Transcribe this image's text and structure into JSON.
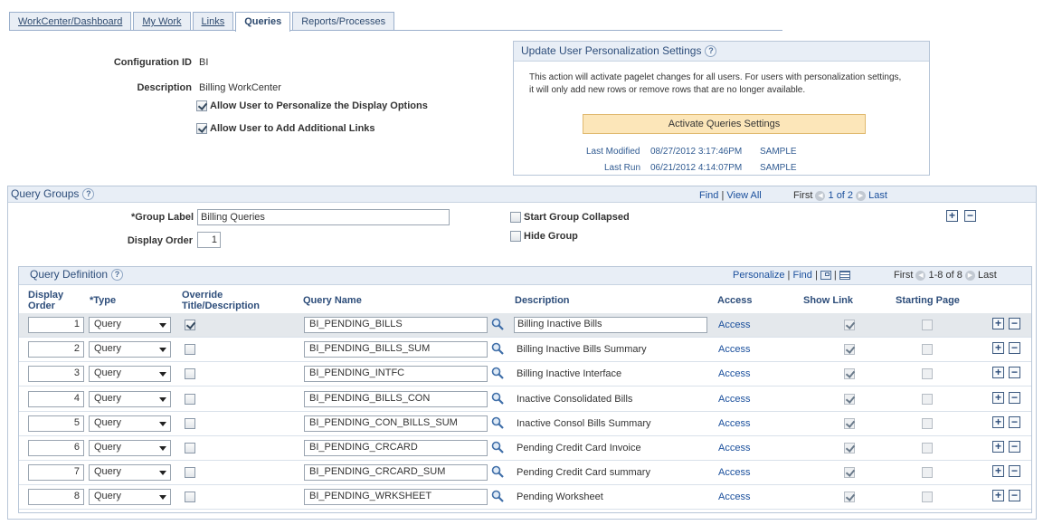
{
  "tabs": [
    {
      "label": "WorkCenter/Dashboard",
      "active": false
    },
    {
      "label": "My Work",
      "active": false
    },
    {
      "label": "Links",
      "active": false
    },
    {
      "label": "Queries",
      "active": true
    },
    {
      "label": "Reports/Processes",
      "active": false
    }
  ],
  "config": {
    "id_label": "Configuration ID",
    "id_value": "BI",
    "desc_label": "Description",
    "desc_value": "Billing WorkCenter",
    "allow_personalize_label": "Allow User to Personalize the Display Options",
    "allow_personalize_checked": true,
    "allow_links_label": "Allow User to Add Additional Links",
    "allow_links_checked": true
  },
  "update_panel": {
    "title": "Update User Personalization Settings",
    "text_line1": "This action will activate pagelet changes for all users.  For users with personalization settings,",
    "text_line2": "it will only add new rows or remove rows that are no longer available.",
    "button_label": "Activate Queries Settings",
    "last_modified_label": "Last Modified",
    "last_modified_value": "08/27/2012  3:17:46PM",
    "last_modified_user": "SAMPLE",
    "last_run_label": "Last Run",
    "last_run_value": "06/21/2012  4:14:07PM",
    "last_run_user": "SAMPLE"
  },
  "query_groups": {
    "title": "Query Groups",
    "find": "Find",
    "sep": "|",
    "view_all": "View All",
    "first": "First",
    "count": "1 of 2",
    "last": "Last",
    "group_label_label": "*Group Label",
    "group_label_value": "Billing Queries",
    "display_order_label": "Display Order",
    "display_order_value": "1",
    "start_collapsed_label": "Start Group Collapsed",
    "hide_group_label": "Hide Group"
  },
  "query_definition": {
    "title": "Query Definition",
    "personalize": "Personalize",
    "find": "Find",
    "first": "First",
    "count": "1-8 of 8",
    "last": "Last",
    "columns": {
      "display_order_1": "Display",
      "display_order_2": "Order",
      "type": "*Type",
      "override_1": "Override",
      "override_2": "Title/Description",
      "query_name": "Query Name",
      "description": "Description",
      "access": "Access",
      "show_link": "Show Link",
      "starting_page": "Starting Page"
    },
    "rows": [
      {
        "order": "1",
        "type": "Query",
        "override": true,
        "query_name": "BI_PENDING_BILLS",
        "description": "Billing Inactive Bills",
        "access": "Access",
        "show_link": true,
        "starting_page": false
      },
      {
        "order": "2",
        "type": "Query",
        "override": false,
        "query_name": "BI_PENDING_BILLS_SUM",
        "description": "Billing Inactive Bills Summary",
        "access": "Access",
        "show_link": true,
        "starting_page": false
      },
      {
        "order": "3",
        "type": "Query",
        "override": false,
        "query_name": "BI_PENDING_INTFC",
        "description": "Billing Inactive Interface",
        "access": "Access",
        "show_link": true,
        "starting_page": false
      },
      {
        "order": "4",
        "type": "Query",
        "override": false,
        "query_name": "BI_PENDING_BILLS_CON",
        "description": "Inactive Consolidated Bills",
        "access": "Access",
        "show_link": true,
        "starting_page": false
      },
      {
        "order": "5",
        "type": "Query",
        "override": false,
        "query_name": "BI_PENDING_CON_BILLS_SUM",
        "description": "Inactive Consol Bills Summary",
        "access": "Access",
        "show_link": true,
        "starting_page": false
      },
      {
        "order": "6",
        "type": "Query",
        "override": false,
        "query_name": "BI_PENDING_CRCARD",
        "description": "Pending Credit Card Invoice",
        "access": "Access",
        "show_link": true,
        "starting_page": false
      },
      {
        "order": "7",
        "type": "Query",
        "override": false,
        "query_name": "BI_PENDING_CRCARD_SUM",
        "description": "Pending Credit Card summary",
        "access": "Access",
        "show_link": true,
        "starting_page": false
      },
      {
        "order": "8",
        "type": "Query",
        "override": false,
        "query_name": "BI_PENDING_WRKSHEET",
        "description": "Pending Worksheet",
        "access": "Access",
        "show_link": true,
        "starting_page": false
      }
    ]
  },
  "icons": {
    "add": "plus-icon",
    "delete": "minus-icon",
    "lookup": "magnifier-icon",
    "help": "help-icon",
    "prev": "prev-arrow-icon",
    "next": "next-arrow-icon"
  }
}
